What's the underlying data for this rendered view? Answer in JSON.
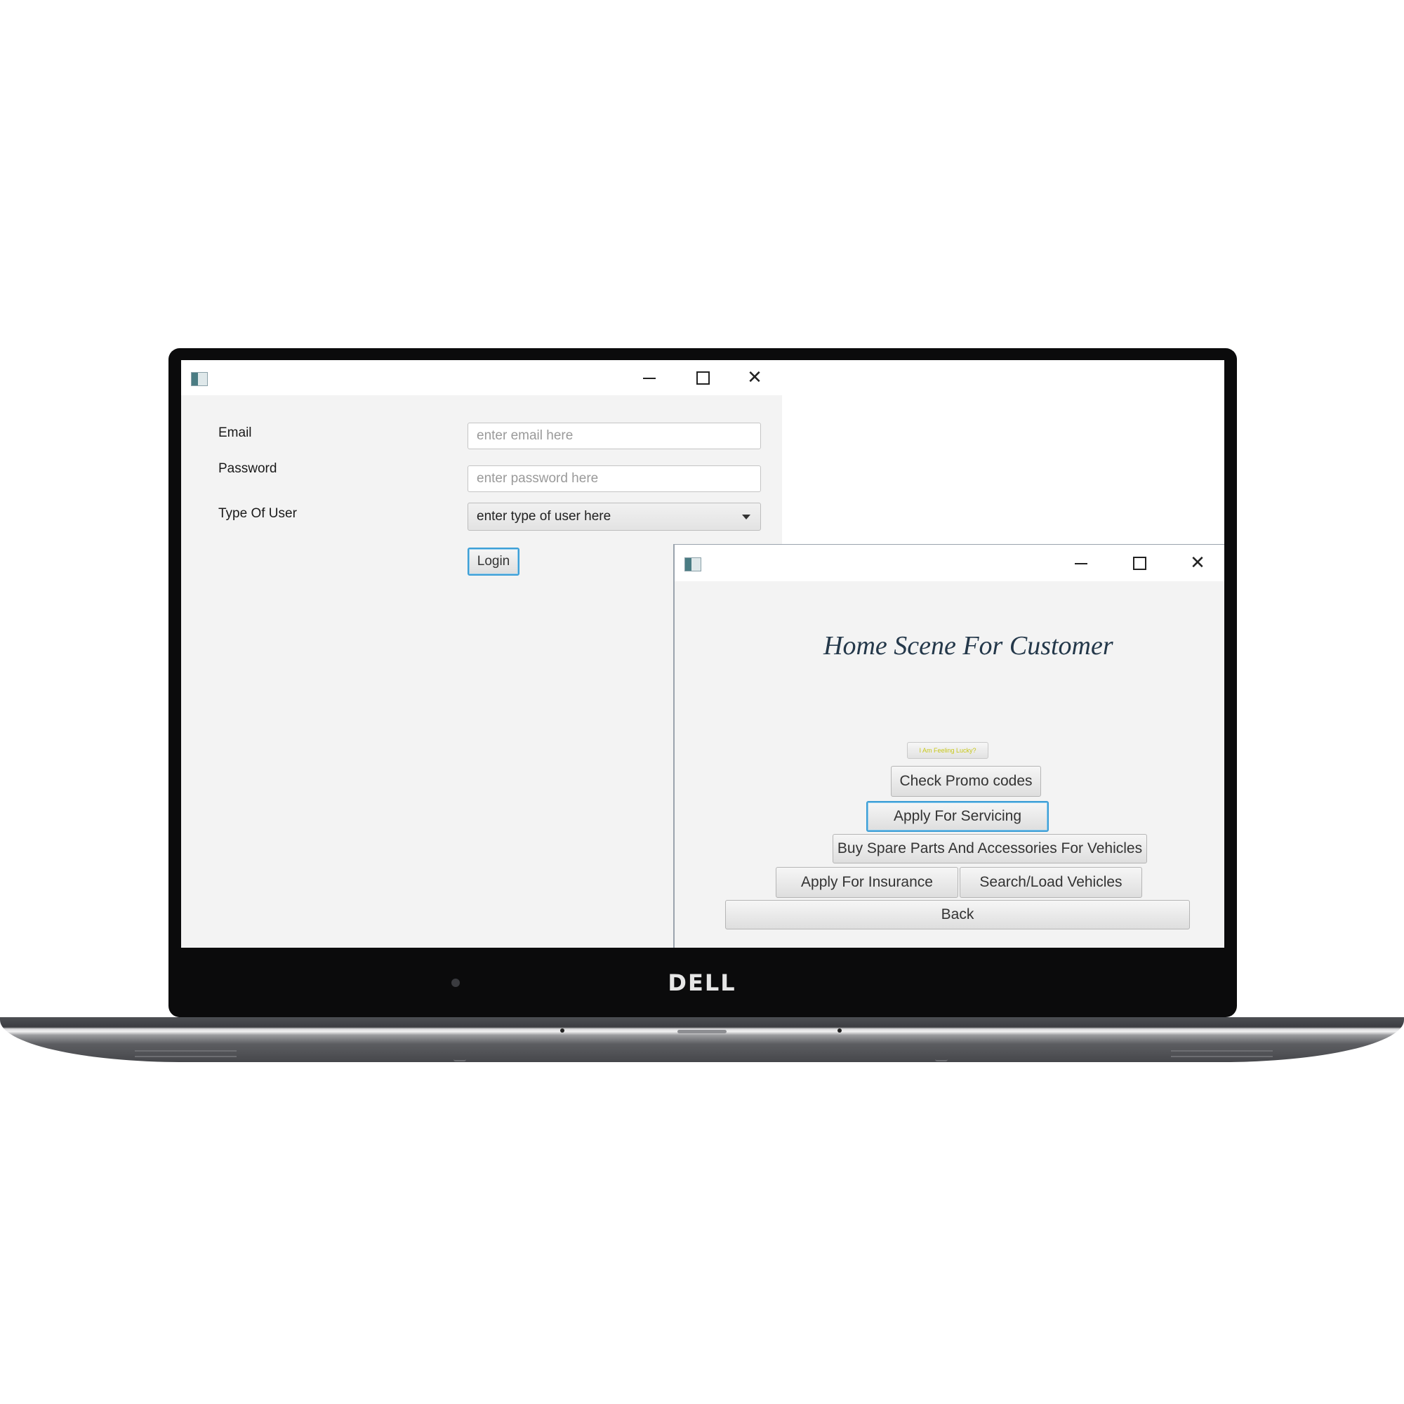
{
  "device": {
    "brand": "DELL"
  },
  "login_window": {
    "email_label": "Email",
    "email_placeholder": "enter email here",
    "password_label": "Password",
    "password_placeholder": "enter password here",
    "user_type_label": "Type Of User",
    "user_type_selected": "enter type of user here",
    "login_button": "Login"
  },
  "customer_window": {
    "title": "Home Scene For Customer",
    "feeling_lucky_button": "I Am Feeling Lucky?",
    "check_promo_button": "Check Promo codes",
    "apply_servicing_button": "Apply For Servicing",
    "buy_parts_button": "Buy Spare Parts And Accessories For Vehicles",
    "apply_insurance_button": "Apply For Insurance",
    "search_vehicles_button": "Search/Load Vehicles",
    "back_button": "Back"
  },
  "icons": {
    "window_icon": "app-icon",
    "minimize": "minimize-icon",
    "maximize": "maximize-icon",
    "close": "close-icon",
    "dropdown": "chevron-down-icon"
  }
}
